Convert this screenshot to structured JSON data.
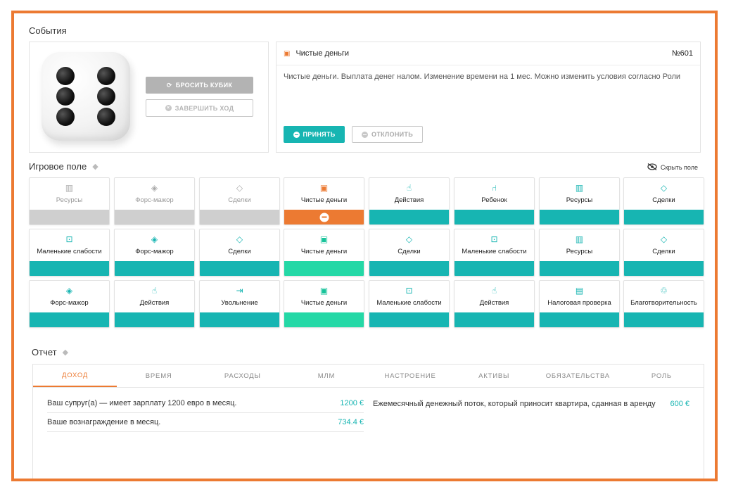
{
  "events": {
    "title": "События",
    "roll_button": "БРОСИТЬ КУБИК",
    "finish_button": "ЗАВЕРШИТЬ ХОД",
    "card": {
      "title": "Чистые деньги",
      "number": "№601",
      "text": "Чистые деньги. Выплата денег налом. Изменение времени на 1 мес. Можно изменить условия согласно Роли",
      "accept": "ПРИНЯТЬ",
      "decline": "ОТКЛОНИТЬ"
    }
  },
  "board": {
    "title": "Игровое поле",
    "hide": "Скрыть поле",
    "cells": [
      {
        "label": "Ресурсы",
        "icon": "building-icon",
        "state": "gray"
      },
      {
        "label": "Форс-мажор",
        "icon": "diamond-alert-icon",
        "state": "gray"
      },
      {
        "label": "Сделки",
        "icon": "tag-icon",
        "state": "gray"
      },
      {
        "label": "Чистые деньги",
        "icon": "money-icon",
        "state": "orange"
      },
      {
        "label": "Действия",
        "icon": "hand-pointer-icon",
        "state": "teal"
      },
      {
        "label": "Ребенок",
        "icon": "chair-icon",
        "state": "teal"
      },
      {
        "label": "Ресурсы",
        "icon": "building-icon",
        "state": "teal"
      },
      {
        "label": "Сделки",
        "icon": "tag-icon",
        "state": "teal"
      },
      {
        "label": "Маленькие слабости",
        "icon": "gamepad-icon",
        "state": "teal"
      },
      {
        "label": "Форс-мажор",
        "icon": "diamond-alert-icon",
        "state": "teal"
      },
      {
        "label": "Сделки",
        "icon": "tag-icon",
        "state": "teal"
      },
      {
        "label": "Чистые деньги",
        "icon": "money-icon",
        "state": "green"
      },
      {
        "label": "Сделки",
        "icon": "tag-icon",
        "state": "teal"
      },
      {
        "label": "Маленькие слабости",
        "icon": "gamepad-icon",
        "state": "teal"
      },
      {
        "label": "Ресурсы",
        "icon": "building-icon",
        "state": "teal"
      },
      {
        "label": "Сделки",
        "icon": "tag-icon",
        "state": "teal"
      },
      {
        "label": "Форс-мажор",
        "icon": "diamond-alert-icon",
        "state": "teal"
      },
      {
        "label": "Действия",
        "icon": "hand-pointer-icon",
        "state": "teal"
      },
      {
        "label": "Увольнение",
        "icon": "exit-icon",
        "state": "teal"
      },
      {
        "label": "Чистые деньги",
        "icon": "money-icon",
        "state": "green"
      },
      {
        "label": "Маленькие слабости",
        "icon": "gamepad-icon",
        "state": "teal"
      },
      {
        "label": "Действия",
        "icon": "hand-pointer-icon",
        "state": "teal"
      },
      {
        "label": "Налоговая проверка",
        "icon": "clipboard-icon",
        "state": "teal"
      },
      {
        "label": "Благотворительность",
        "icon": "charity-icon",
        "state": "teal"
      }
    ]
  },
  "report": {
    "title": "Отчет",
    "tabs": [
      "ДОХОД",
      "ВРЕМЯ",
      "РАСХОДЫ",
      "МЛМ",
      "НАСТРОЕНИЕ",
      "АКТИВЫ",
      "ОБЯЗАТЕЛЬСТВА",
      "РОЛЬ"
    ],
    "left_rows": [
      {
        "label": "Ваш супруг(а) — имеет зарплату 1200 евро в месяц.",
        "value": "1200 €"
      },
      {
        "label": "Ваше вознаграждение в месяц.",
        "value": "734.4 €"
      }
    ],
    "right_rows": [
      {
        "label": "Ежемесячный денежный поток, который приносит квартира, сданная в аренду",
        "value": "600 €"
      }
    ]
  },
  "colors": {
    "accent": "#ec7a32",
    "teal": "#17b5b2",
    "green": "#24d8a6",
    "gray": "#cfcfcf"
  }
}
